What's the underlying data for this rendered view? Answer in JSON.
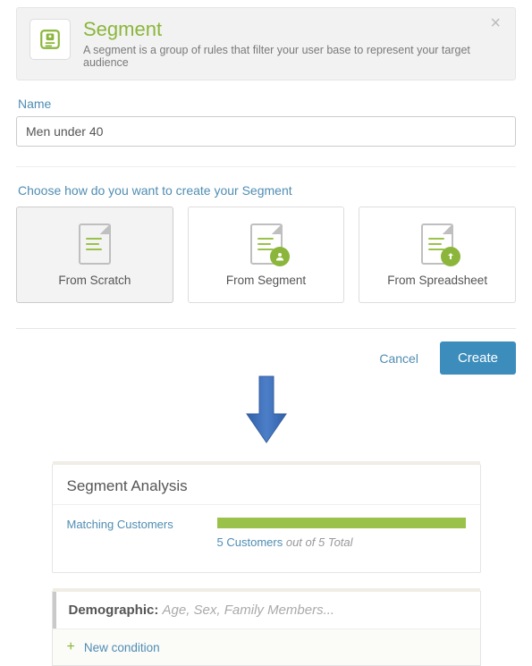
{
  "header": {
    "title": "Segment",
    "subtitle": "A segment is a group of rules that filter your user base to represent your target audience"
  },
  "form": {
    "name_label": "Name",
    "name_value": "Men under 40",
    "choose_label": "Choose how do you want to create your Segment"
  },
  "options": [
    {
      "label": "From Scratch",
      "badge": "none",
      "selected": true
    },
    {
      "label": "From Segment",
      "badge": "avatar",
      "selected": false
    },
    {
      "label": "From Spreadsheet",
      "badge": "upload",
      "selected": false
    }
  ],
  "footer": {
    "cancel": "Cancel",
    "create": "Create"
  },
  "analysis": {
    "title": "Segment Analysis",
    "matching_label": "Matching Customers",
    "matched": 5,
    "total": 5,
    "caption_prefix": "Customers",
    "caption_suffix": "out of 5 Total"
  },
  "demographic": {
    "title": "Demographic:",
    "hint": "Age, Sex, Family Members...",
    "new_condition": "New condition"
  },
  "colors": {
    "accent_green": "#8bb63b",
    "accent_blue": "#3c8dbc",
    "link_blue": "#4f8db3"
  }
}
